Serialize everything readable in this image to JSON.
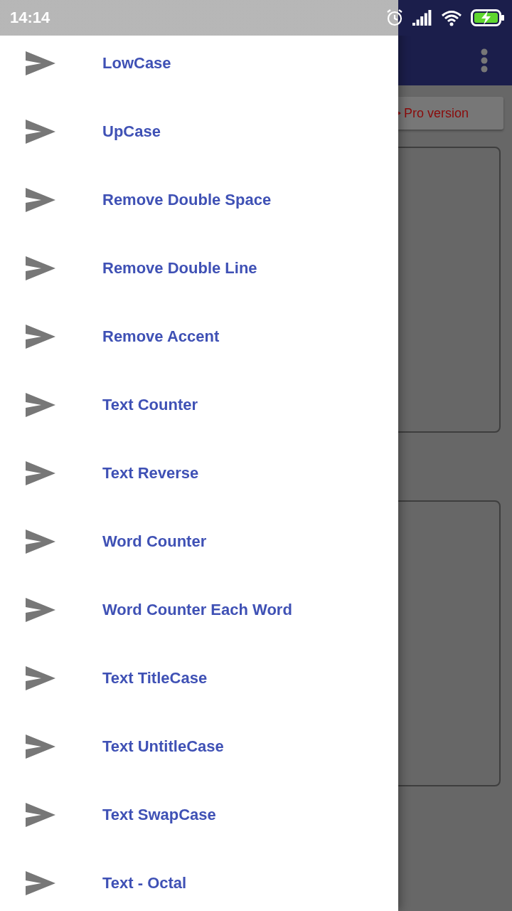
{
  "status_bar": {
    "time": "14:14"
  },
  "drawer": {
    "items": [
      {
        "label": "LowCase"
      },
      {
        "label": "UpCase"
      },
      {
        "label": "Remove Double Space"
      },
      {
        "label": "Remove Double Line"
      },
      {
        "label": "Remove Accent"
      },
      {
        "label": "Text Counter"
      },
      {
        "label": "Text Reverse"
      },
      {
        "label": "Word Counter"
      },
      {
        "label": "Word Counter Each Word"
      },
      {
        "label": "Text TitleCase"
      },
      {
        "label": "Text UntitleCase"
      },
      {
        "label": "Text SwapCase"
      },
      {
        "label": "Text - Octal"
      }
    ]
  },
  "main": {
    "pro_button": "Pro version"
  }
}
